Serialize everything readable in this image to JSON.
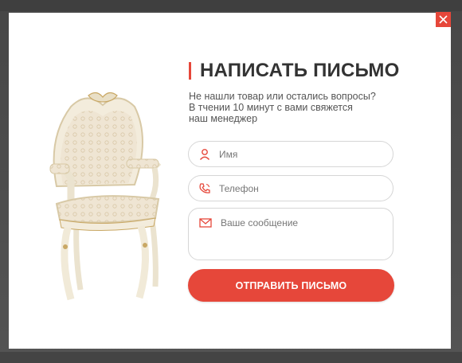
{
  "modal": {
    "title": "НАПИСАТЬ ПИСЬМО",
    "subtitle_lines": [
      "Не нашли товар или остались вопросы?",
      "В тчении 10 минут с вами свяжется",
      "наш менеджер"
    ],
    "fields": {
      "name_placeholder": "Имя",
      "phone_placeholder": "Телефон",
      "message_placeholder": "Ваше сообщение"
    },
    "submit_label": "ОТПРАВИТЬ ПИСЬМО",
    "close_icon": "close-icon",
    "image": "armchair-product-image"
  },
  "colors": {
    "accent": "#e6473a",
    "title": "#333333",
    "text": "#555555",
    "border": "#d6d6d6",
    "overlay": "#4a4a4a"
  }
}
